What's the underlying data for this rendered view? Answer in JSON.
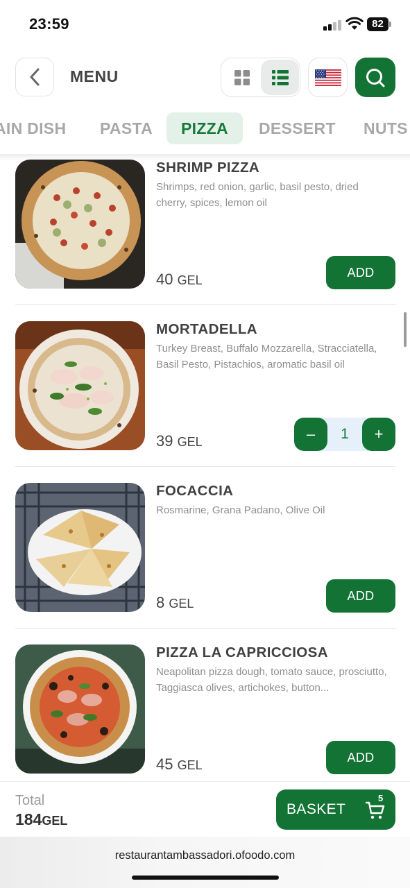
{
  "status_bar": {
    "time": "23:59",
    "battery": "82",
    "icons": [
      "signal-icon",
      "wifi-icon",
      "battery-icon"
    ]
  },
  "header": {
    "title": "MENU",
    "icons": [
      "chevron-left-icon",
      "grid-view-icon",
      "list-view-icon",
      "us-flag-icon",
      "search-icon"
    ]
  },
  "tabs": [
    {
      "label": "AIN DISH",
      "active": false
    },
    {
      "label": "PASTA",
      "active": false
    },
    {
      "label": "PIZZA",
      "active": true
    },
    {
      "label": "DESSERT",
      "active": false
    },
    {
      "label": "NUTS",
      "active": false
    }
  ],
  "items": [
    {
      "name": "SHRIMP PIZZA",
      "description": "Shrimps, red onion, garlic, basil pesto, dried cherry, spices, lemon oil",
      "price": "40",
      "currency": "GEL",
      "action": "ADD"
    },
    {
      "name": "MORTADELLA",
      "description": "Turkey Breast, Buffalo Mozzarella, Stracciatella, Basil Pesto, Pistachios, aromatic basil oil",
      "price": "39",
      "currency": "GEL",
      "quantity": "1",
      "minus": "–",
      "plus": "+"
    },
    {
      "name": "FOCACCIA",
      "description": "Rosmarine, Grana Padano, Olive Oil",
      "price": "8",
      "currency": "GEL",
      "action": "ADD"
    },
    {
      "name": "PIZZA LA CAPRICCIOSA",
      "description": "Neapolitan pizza dough, tomato sauce, prosciutto, Taggiasca olives, artichokes, button...",
      "price": "45",
      "currency": "GEL",
      "action": "ADD"
    }
  ],
  "footer": {
    "total_label": "Total",
    "total_value": "184",
    "total_currency": "GEL",
    "basket_label": "BASKET",
    "basket_count": "5"
  },
  "browser": {
    "url": "restaurantambassadori.ofoodo.com"
  },
  "colors": {
    "brand_green": "#137334",
    "tab_active_bg": "#e4f1e8",
    "stepper_bg": "#e6f0fb"
  }
}
